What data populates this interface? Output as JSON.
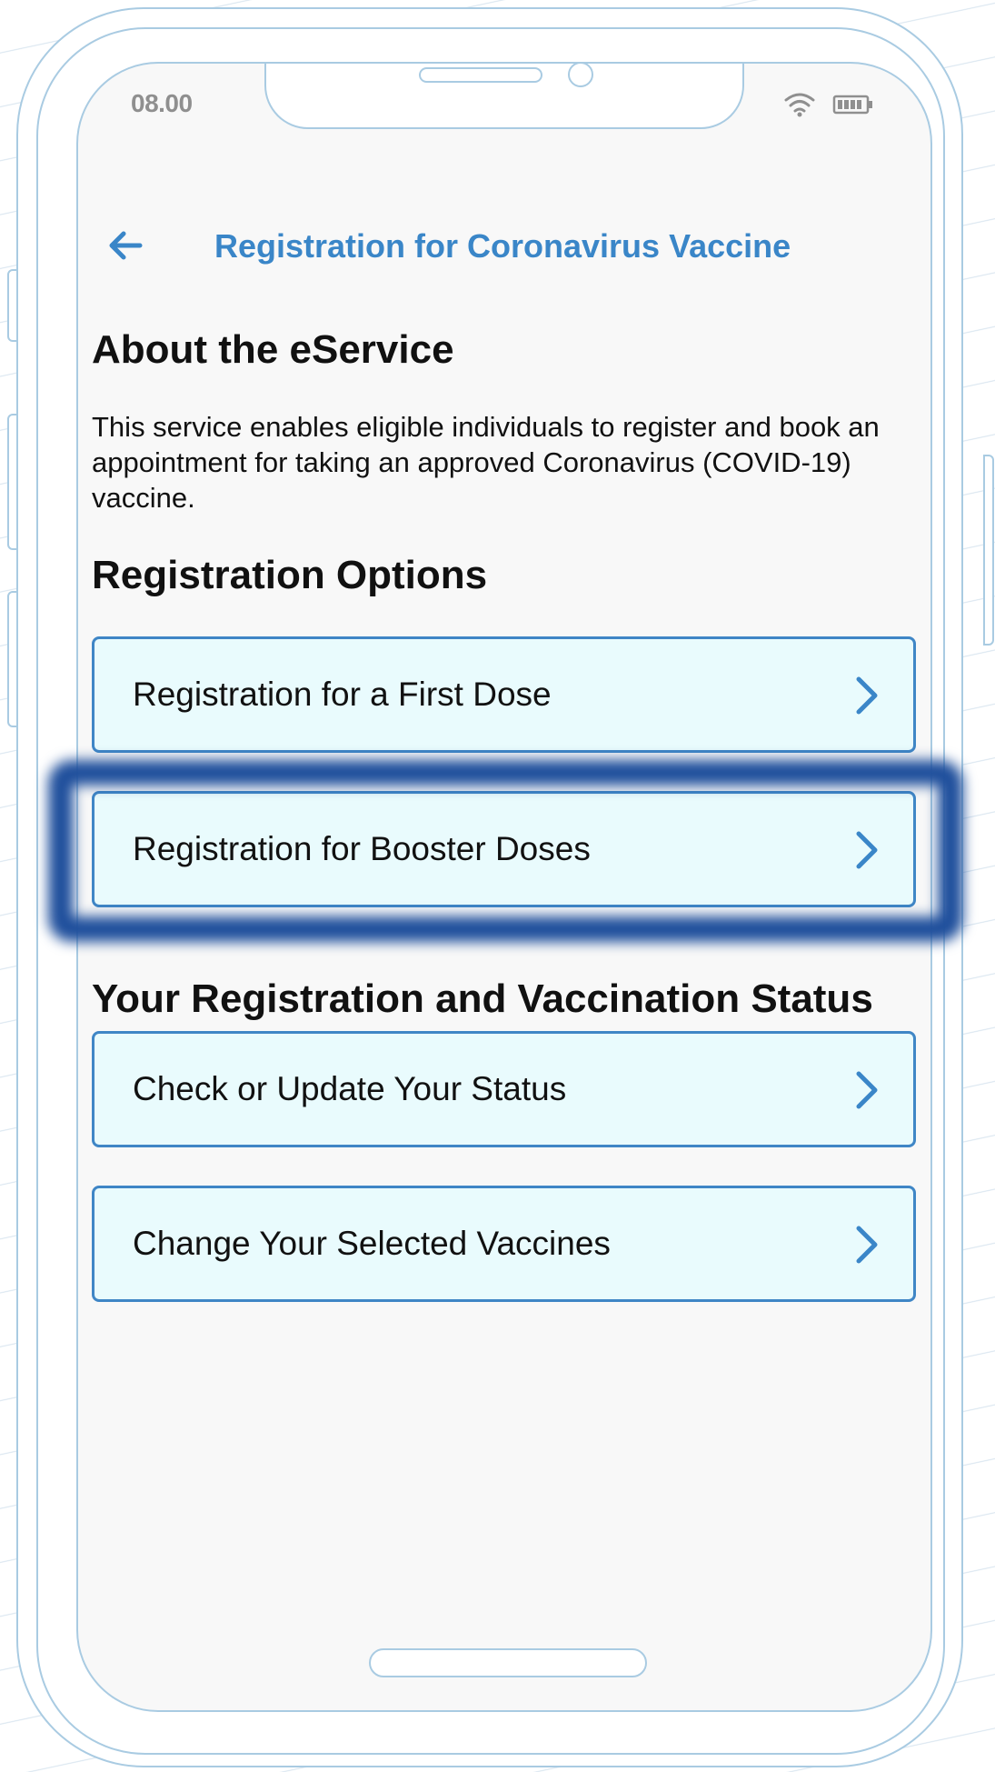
{
  "status_bar": {
    "time": "08.00"
  },
  "header": {
    "title": "Registration for Coronavirus Vaccine"
  },
  "about": {
    "heading": "About the eService",
    "description": "This service enables eligible individuals to register and book an appointment for taking an approved Coronavirus (COVID-19) vaccine."
  },
  "registration_options": {
    "heading": "Registration Options",
    "items": [
      {
        "label": "Registration for a First Dose"
      },
      {
        "label": "Registration for Booster Doses"
      }
    ]
  },
  "status_section": {
    "heading": "Your Registration and Vaccination Status",
    "items": [
      {
        "label": "Check or Update Your Status"
      },
      {
        "label": "Change Your Selected Vaccines"
      }
    ]
  },
  "colors": {
    "accent": "#3a86c8",
    "option_bg": "#e9fbfd",
    "option_border": "#3f86c6",
    "highlight": "#1f4f9c"
  }
}
